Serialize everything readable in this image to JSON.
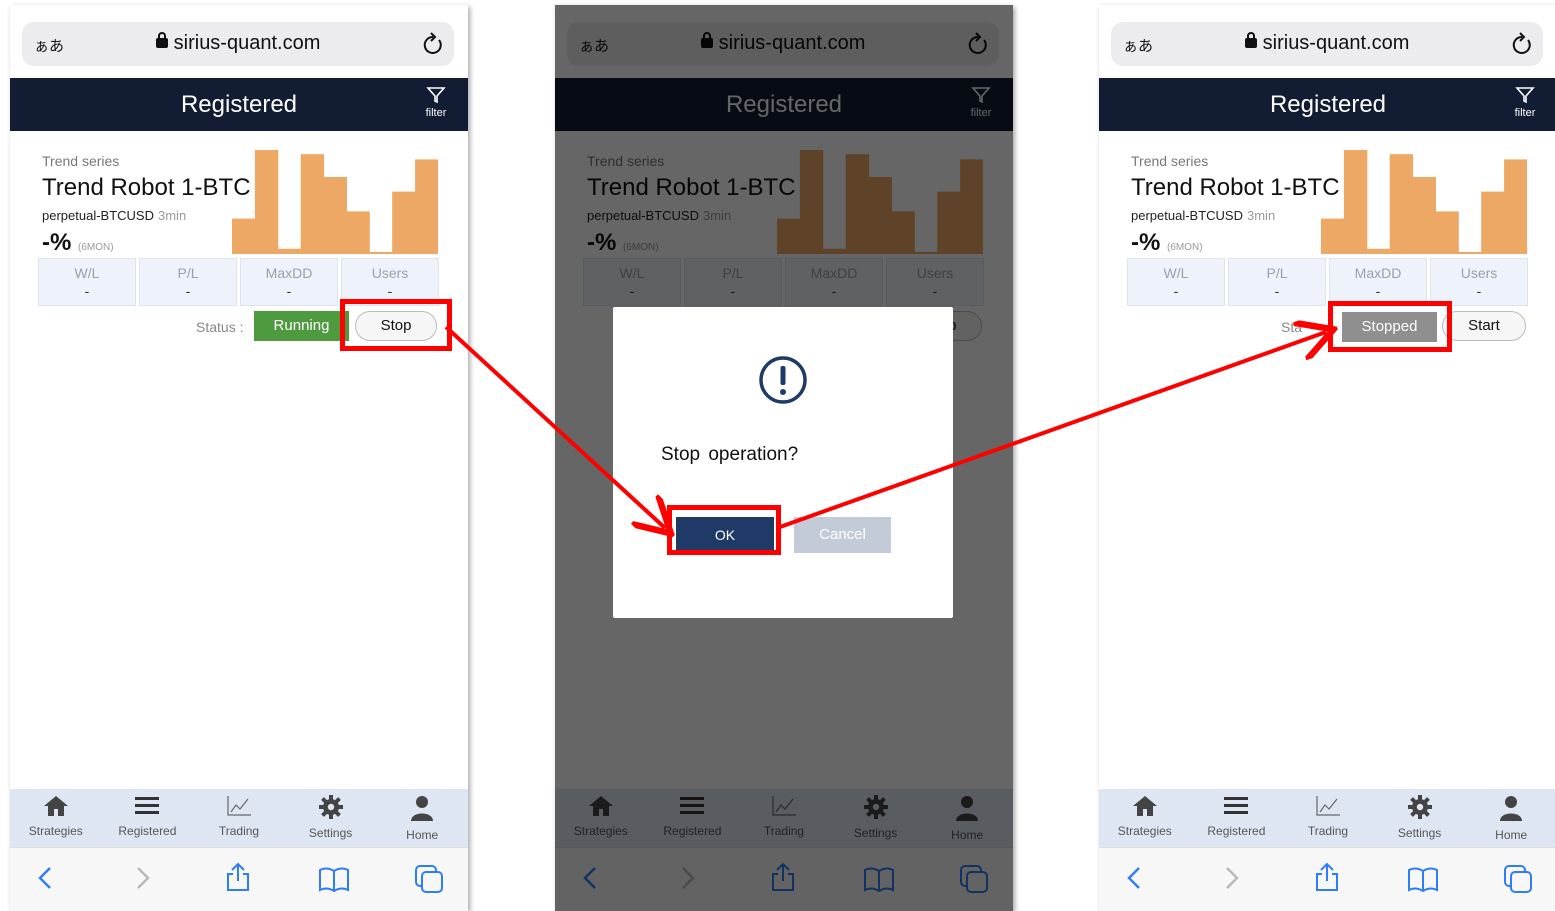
{
  "browser": {
    "text_size_label": "ぁあ",
    "domain": "sirius-quant.com"
  },
  "header": {
    "title": "Registered",
    "filter_label": "filter"
  },
  "card": {
    "series": "Trend series",
    "title": "Trend Robot 1-BTC",
    "pair": "perpetual-BTCUSD",
    "timeframe": "3min",
    "return_value": "-%",
    "return_period": "(6MON)",
    "chart_bars": [
      0.34,
      1.0,
      0.05,
      0.96,
      0.74,
      0.41,
      0.02,
      0.6,
      0.91
    ]
  },
  "stats": [
    {
      "label": "W/L",
      "value": "-"
    },
    {
      "label": "P/L",
      "value": "-"
    },
    {
      "label": "MaxDD",
      "value": "-"
    },
    {
      "label": "Users",
      "value": "-"
    }
  ],
  "status": {
    "label": "Status :",
    "running": "Running",
    "stop": "Stop",
    "stopped": "Stopped",
    "start": "Start",
    "partial_label": "Sta"
  },
  "dialog": {
    "message": "Stop  operation?",
    "ok": "OK",
    "cancel": "Cancel"
  },
  "tabs": [
    {
      "label": "Strategies",
      "icon": "home-icon"
    },
    {
      "label": "Registered",
      "icon": "list-icon"
    },
    {
      "label": "Trading",
      "icon": "chart-icon"
    },
    {
      "label": "Settings",
      "icon": "gear-icon"
    },
    {
      "label": "Home",
      "icon": "user-icon"
    }
  ],
  "colors": {
    "header_bg": "#121d33",
    "chart_bar": "#eda866",
    "running_green": "#4e9a3f",
    "ok_blue": "#1f3a66",
    "highlight_red": "#ff0000"
  }
}
